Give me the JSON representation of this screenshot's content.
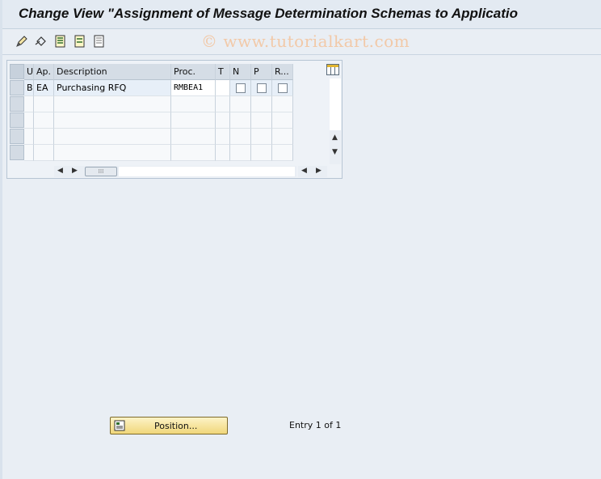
{
  "window": {
    "title": "Change View \"Assignment of Message Determination Schemas to Applicatio",
    "watermark": "© www.tutorialkart.com"
  },
  "toolbar": {
    "buttons": [
      {
        "icon": "edit-pencil-icon"
      },
      {
        "icon": "undo-icon"
      },
      {
        "icon": "select-all-icon"
      },
      {
        "icon": "select-block-icon"
      },
      {
        "icon": "deselect-all-icon"
      }
    ]
  },
  "table": {
    "columns": [
      "U",
      "Ap.",
      "Description",
      "Proc.",
      "T",
      "N",
      "P",
      "R..."
    ],
    "rows": [
      {
        "u": "B",
        "ap": "EA",
        "description": "Purchasing RFQ",
        "proc": "RMBEA1",
        "t": "",
        "n": false,
        "p": false,
        "r": false
      },
      {
        "u": "",
        "ap": "",
        "description": "",
        "proc": "",
        "t": "",
        "n": null,
        "p": null,
        "r": null
      },
      {
        "u": "",
        "ap": "",
        "description": "",
        "proc": "",
        "t": "",
        "n": null,
        "p": null,
        "r": null
      },
      {
        "u": "",
        "ap": "",
        "description": "",
        "proc": "",
        "t": "",
        "n": null,
        "p": null,
        "r": null
      },
      {
        "u": "",
        "ap": "",
        "description": "",
        "proc": "",
        "t": "",
        "n": null,
        "p": null,
        "r": null
      }
    ]
  },
  "footer": {
    "position_button": "Position...",
    "entry_text": "Entry 1 of 1"
  }
}
